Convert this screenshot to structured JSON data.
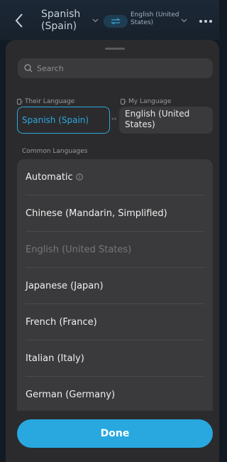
{
  "header": {
    "source_language": "Spanish (Spain)",
    "target_language": "English (United States)"
  },
  "search": {
    "placeholder": "Search"
  },
  "selector": {
    "their_label": "Their Language",
    "my_label": "My Language",
    "their_value": "Spanish (Spain)",
    "my_value": "English (United States)"
  },
  "common": {
    "heading": "Common Languages",
    "items": [
      {
        "label": "Automatic",
        "disabled": false,
        "info_icon": true
      },
      {
        "label": "Chinese (Mandarin, Simplified)",
        "disabled": false
      },
      {
        "label": "English (United States)",
        "disabled": true
      },
      {
        "label": "Japanese (Japan)",
        "disabled": false
      },
      {
        "label": "French (France)",
        "disabled": false
      },
      {
        "label": "Italian (Italy)",
        "disabled": false
      },
      {
        "label": "German (Germany)",
        "disabled": false
      }
    ]
  },
  "actions": {
    "done_label": "Done"
  },
  "colors": {
    "accent": "#28a8df",
    "sheet": "#2b2b2d",
    "row": "#3a3a3c"
  }
}
